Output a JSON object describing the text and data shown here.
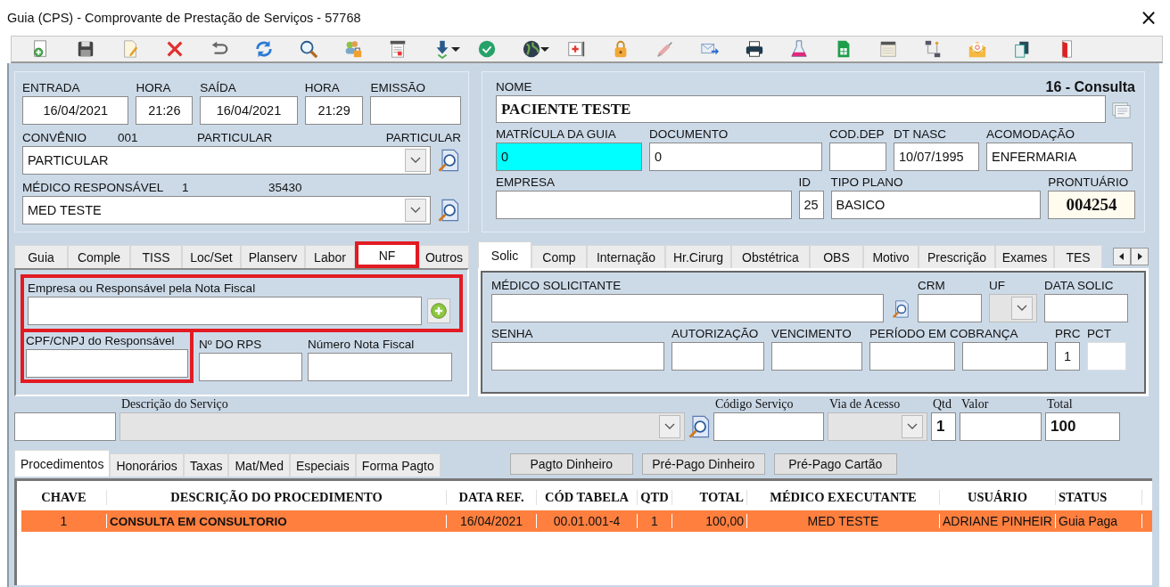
{
  "window": {
    "title": "Guia (CPS) - Comprovante de Prestação de Serviços - 57768",
    "close": "×"
  },
  "header": {
    "dates": [
      {
        "label": "ENTRADA",
        "value": "16/04/2021"
      },
      {
        "label": "HORA",
        "value": "21:26"
      },
      {
        "label": "SAÍDA",
        "value": "16/04/2021"
      },
      {
        "label": "HORA",
        "value": "21:29"
      },
      {
        "label": "EMISSÃO"
      }
    ],
    "convenio": {
      "label": "CONVÊNIO",
      "code": "001",
      "name": "PARTICULAR",
      "category": "PARTICULAR",
      "value": "PARTICULAR"
    },
    "medico": {
      "label": "MÉDICO RESPONSÁVEL",
      "code": "1",
      "crm": "35430",
      "value": "MED TESTE"
    }
  },
  "patient": {
    "procedure_type": "16 - Consulta",
    "nome": {
      "label": "NOME",
      "value": "PACIENTE TESTE"
    },
    "row_1": [
      {
        "label": "MATRÍCULA DA GUIA",
        "value": "0",
        "focused": true
      },
      {
        "label": "DOCUMENTO",
        "value": "0",
        "focused": false
      },
      {
        "label": "COD.DEP",
        "focused": false
      },
      {
        "label": "DT NASC",
        "value": "10/07/1995",
        "focused": false
      },
      {
        "label": "ACOMODAÇÃO",
        "value": "ENFERMARIA",
        "focused": false
      }
    ],
    "row_2": [
      {
        "label": "EMPRESA"
      },
      {
        "label": "ID",
        "value": "25"
      },
      {
        "label": "TIPO PLANO",
        "value": "BASICO"
      },
      {
        "label": "PRONTUÁRIO",
        "value": "004254"
      }
    ]
  },
  "left_tabs": [
    {
      "label": "Guia",
      "selected": false,
      "highlighted": false
    },
    {
      "label": "Comple",
      "selected": false,
      "highlighted": false
    },
    {
      "label": "TISS",
      "selected": false,
      "highlighted": false
    },
    {
      "label": "Loc/Set",
      "selected": false,
      "highlighted": false
    },
    {
      "label": "Planserv",
      "selected": false,
      "highlighted": false
    },
    {
      "label": "Labor",
      "selected": false,
      "highlighted": false
    },
    {
      "label": "NF",
      "selected": true,
      "highlighted": true
    },
    {
      "label": "Outros",
      "selected": false,
      "highlighted": false
    }
  ],
  "nf_panel": {
    "responsavel": {
      "label": "Empresa ou Responsável pela Nota Fiscal",
      "highlighted": true
    },
    "fields": [
      {
        "label": "CPF/CNPJ do Responsável",
        "highlighted": true
      },
      {
        "label": "Nº DO RPS",
        "highlighted": false
      },
      {
        "label": "Número Nota Fiscal",
        "highlighted": false
      }
    ]
  },
  "right_tabs": [
    {
      "label": "Solic",
      "selected": true
    },
    {
      "label": "Comp",
      "selected": false
    },
    {
      "label": "Internação",
      "selected": false
    },
    {
      "label": "Hr.Cirurg",
      "selected": false
    },
    {
      "label": "Obstétrica",
      "selected": false
    },
    {
      "label": "OBS",
      "selected": false
    },
    {
      "label": "Motivo",
      "selected": false
    },
    {
      "label": "Prescrição",
      "selected": false
    },
    {
      "label": "Exames",
      "selected": false
    },
    {
      "label": "TES",
      "selected": false
    }
  ],
  "solic_panel": {
    "row_1": [
      {
        "label": "MÉDICO SOLICITANTE"
      },
      {
        "label": "CRM"
      },
      {
        "label": "UF"
      },
      {
        "label": "DATA SOLIC"
      }
    ],
    "row_2": [
      {
        "label": "SENHA"
      },
      {
        "label": "AUTORIZAÇÃO"
      },
      {
        "label": "VENCIMENTO"
      },
      {
        "label": "PERÍODO EM COBRANÇA"
      },
      {
        "label": "PRC",
        "value": "1"
      },
      {
        "label": "PCT"
      }
    ]
  },
  "service": {
    "fields": [
      {
        "label": "Descrição do Serviço"
      },
      {
        "label": "Código Serviço"
      },
      {
        "label": "Via de Acesso"
      },
      {
        "label": "Qtd",
        "value": "1"
      },
      {
        "label": "Valor"
      },
      {
        "label": "Total",
        "value": "100"
      }
    ]
  },
  "bottom_tabs": [
    {
      "label": "Procedimentos",
      "selected": true
    },
    {
      "label": "Honorários",
      "selected": false
    },
    {
      "label": "Taxas",
      "selected": false
    },
    {
      "label": "Mat/Med",
      "selected": false
    },
    {
      "label": "Especiais",
      "selected": false
    },
    {
      "label": "Forma Pagto",
      "selected": false
    }
  ],
  "payment_buttons": [
    "Pagto Dinheiro",
    "Pré-Pago Dinheiro",
    "Pré-Pago Cartão"
  ],
  "table": {
    "columns": [
      "CHAVE",
      "DESCRIÇÃO DO PROCEDIMENTO",
      "DATA REF.",
      "CÓD TABELA",
      "QTD",
      "TOTAL",
      "MÉDICO EXECUTANTE",
      "USUÁRIO",
      "STATUS"
    ],
    "rows": [
      {
        "selected": true,
        "cells": [
          "1",
          "CONSULTA EM CONSULTORIO",
          "16/04/2021",
          "00.01.001-4",
          "1",
          "100,00",
          "MED TESTE",
          "ADRIANE PINHEIR",
          "Guia Paga"
        ]
      }
    ]
  }
}
